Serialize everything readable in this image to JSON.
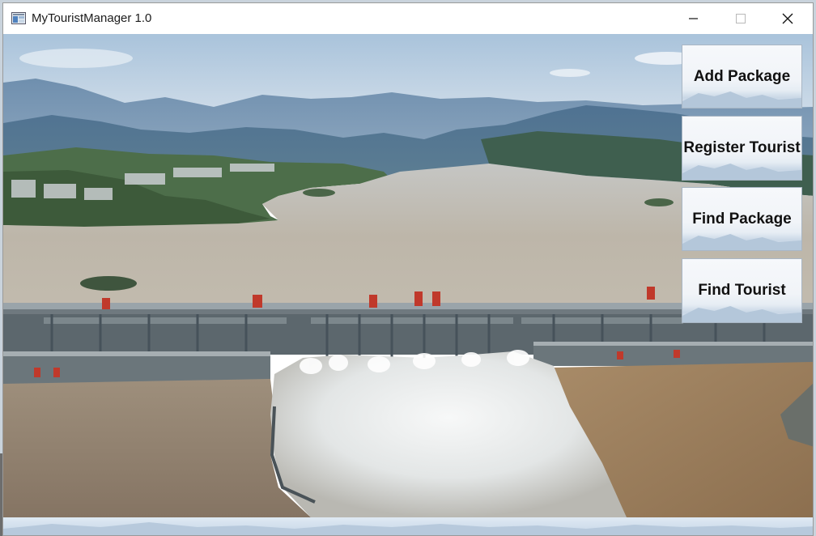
{
  "window": {
    "title": "MyTouristManager 1.0",
    "icon": "app-window-icon",
    "controls": [
      "minimize-icon",
      "maximize-icon",
      "close-icon"
    ]
  },
  "background_image": "dam-spillway-river-landscape",
  "buttons": [
    {
      "label": "Add Package"
    },
    {
      "label": "Register Tourist"
    },
    {
      "label": "Find Package"
    },
    {
      "label": "Find Tourist"
    }
  ],
  "colors": {
    "sky": "#c3d6e6",
    "water": "#b9b5ab",
    "muddy_river": "#a88a67",
    "dam": "#5e6a71",
    "spray": "#eef0f0",
    "button_border": "#a9b6c4"
  }
}
